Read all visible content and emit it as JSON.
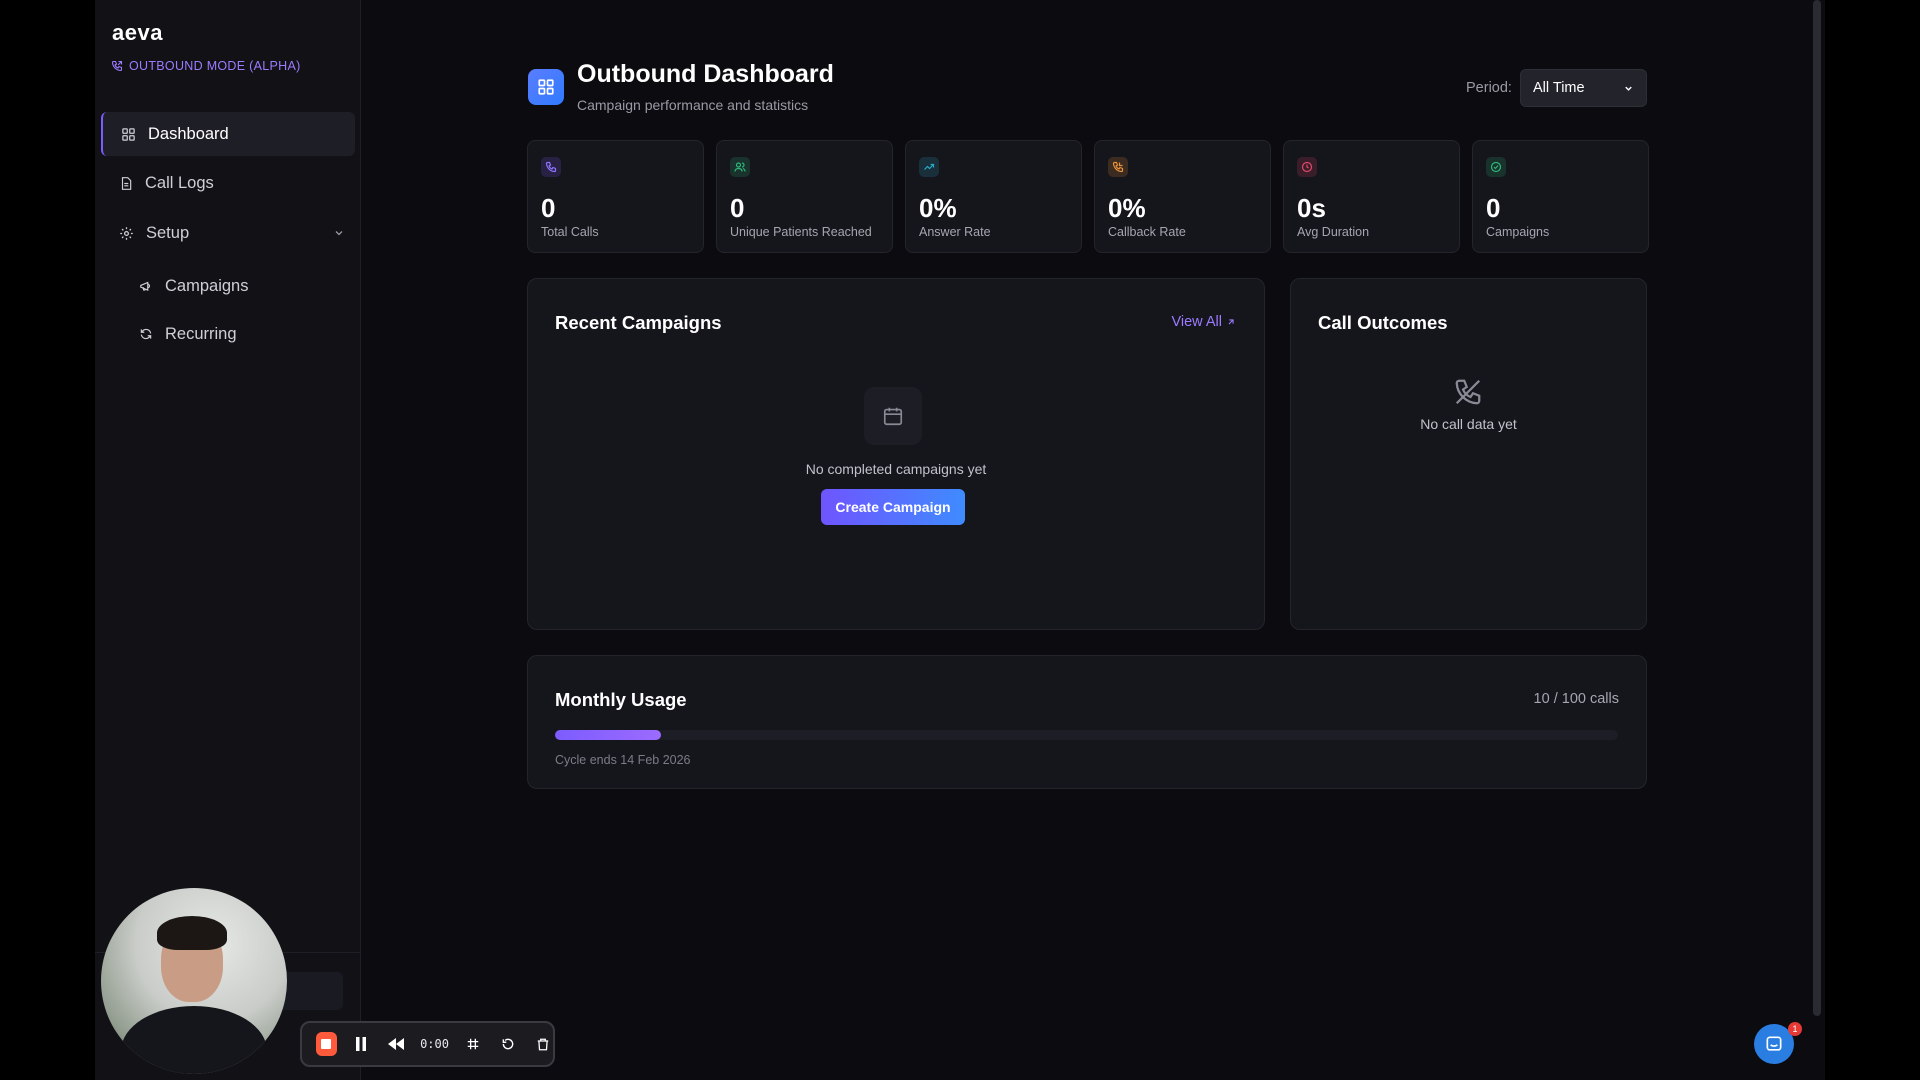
{
  "app": {
    "logo": "aeva",
    "mode": "OUTBOUND MODE (ALPHA)"
  },
  "sidebar": {
    "items": [
      {
        "label": "Dashboard"
      },
      {
        "label": "Call Logs"
      },
      {
        "label": "Setup"
      },
      {
        "label": "Campaigns"
      },
      {
        "label": "Recurring"
      }
    ]
  },
  "header": {
    "title": "Outbound Dashboard",
    "subtitle": "Campaign performance and statistics",
    "period_label": "Period:",
    "period_value": "All Time"
  },
  "stats": [
    {
      "value": "0",
      "label": "Total Calls",
      "color": "#7c5cff",
      "icon": "phone-icon"
    },
    {
      "value": "0",
      "label": "Unique Patients Reached",
      "color": "#2fb67c",
      "icon": "users-icon"
    },
    {
      "value": "0%",
      "label": "Answer Rate",
      "color": "#2aa8c9",
      "icon": "trend-up-icon"
    },
    {
      "value": "0%",
      "label": "Callback Rate",
      "color": "#e8913a",
      "icon": "phone-callback-icon"
    },
    {
      "value": "0s",
      "label": "Avg Duration",
      "color": "#e0486b",
      "icon": "clock-icon"
    },
    {
      "value": "0",
      "label": "Campaigns",
      "color": "#2fb67c",
      "icon": "check-circle-icon"
    }
  ],
  "recent_campaigns": {
    "title": "Recent Campaigns",
    "view_all": "View All",
    "empty_text": "No completed campaigns yet",
    "create_button": "Create Campaign"
  },
  "call_outcomes": {
    "title": "Call Outcomes",
    "empty_text": "No call data yet"
  },
  "monthly_usage": {
    "title": "Monthly Usage",
    "count": "10 / 100 calls",
    "progress": 0.1,
    "cycle": "Cycle ends 14 Feb 2026"
  },
  "recorder": {
    "time": "0:00"
  },
  "chat": {
    "badge": "1"
  }
}
